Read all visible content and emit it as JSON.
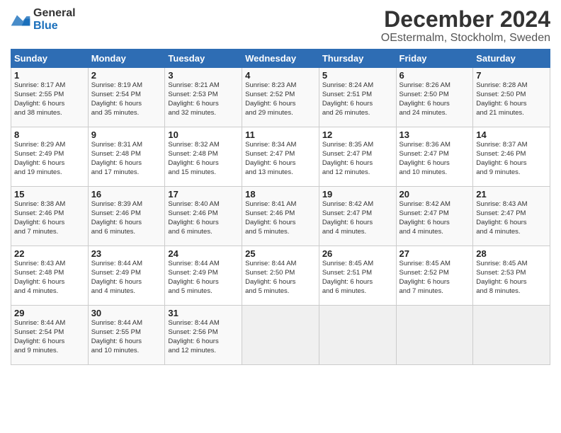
{
  "logo": {
    "general": "General",
    "blue": "Blue"
  },
  "title": "December 2024",
  "subtitle": "OEstermalm, Stockholm, Sweden",
  "headers": [
    "Sunday",
    "Monday",
    "Tuesday",
    "Wednesday",
    "Thursday",
    "Friday",
    "Saturday"
  ],
  "weeks": [
    [
      {
        "day": "1",
        "lines": [
          "Sunrise: 8:17 AM",
          "Sunset: 2:55 PM",
          "Daylight: 6 hours",
          "and 38 minutes."
        ]
      },
      {
        "day": "2",
        "lines": [
          "Sunrise: 8:19 AM",
          "Sunset: 2:54 PM",
          "Daylight: 6 hours",
          "and 35 minutes."
        ]
      },
      {
        "day": "3",
        "lines": [
          "Sunrise: 8:21 AM",
          "Sunset: 2:53 PM",
          "Daylight: 6 hours",
          "and 32 minutes."
        ]
      },
      {
        "day": "4",
        "lines": [
          "Sunrise: 8:23 AM",
          "Sunset: 2:52 PM",
          "Daylight: 6 hours",
          "and 29 minutes."
        ]
      },
      {
        "day": "5",
        "lines": [
          "Sunrise: 8:24 AM",
          "Sunset: 2:51 PM",
          "Daylight: 6 hours",
          "and 26 minutes."
        ]
      },
      {
        "day": "6",
        "lines": [
          "Sunrise: 8:26 AM",
          "Sunset: 2:50 PM",
          "Daylight: 6 hours",
          "and 24 minutes."
        ]
      },
      {
        "day": "7",
        "lines": [
          "Sunrise: 8:28 AM",
          "Sunset: 2:50 PM",
          "Daylight: 6 hours",
          "and 21 minutes."
        ]
      }
    ],
    [
      {
        "day": "8",
        "lines": [
          "Sunrise: 8:29 AM",
          "Sunset: 2:49 PM",
          "Daylight: 6 hours",
          "and 19 minutes."
        ]
      },
      {
        "day": "9",
        "lines": [
          "Sunrise: 8:31 AM",
          "Sunset: 2:48 PM",
          "Daylight: 6 hours",
          "and 17 minutes."
        ]
      },
      {
        "day": "10",
        "lines": [
          "Sunrise: 8:32 AM",
          "Sunset: 2:48 PM",
          "Daylight: 6 hours",
          "and 15 minutes."
        ]
      },
      {
        "day": "11",
        "lines": [
          "Sunrise: 8:34 AM",
          "Sunset: 2:47 PM",
          "Daylight: 6 hours",
          "and 13 minutes."
        ]
      },
      {
        "day": "12",
        "lines": [
          "Sunrise: 8:35 AM",
          "Sunset: 2:47 PM",
          "Daylight: 6 hours",
          "and 12 minutes."
        ]
      },
      {
        "day": "13",
        "lines": [
          "Sunrise: 8:36 AM",
          "Sunset: 2:47 PM",
          "Daylight: 6 hours",
          "and 10 minutes."
        ]
      },
      {
        "day": "14",
        "lines": [
          "Sunrise: 8:37 AM",
          "Sunset: 2:46 PM",
          "Daylight: 6 hours",
          "and 9 minutes."
        ]
      }
    ],
    [
      {
        "day": "15",
        "lines": [
          "Sunrise: 8:38 AM",
          "Sunset: 2:46 PM",
          "Daylight: 6 hours",
          "and 7 minutes."
        ]
      },
      {
        "day": "16",
        "lines": [
          "Sunrise: 8:39 AM",
          "Sunset: 2:46 PM",
          "Daylight: 6 hours",
          "and 6 minutes."
        ]
      },
      {
        "day": "17",
        "lines": [
          "Sunrise: 8:40 AM",
          "Sunset: 2:46 PM",
          "Daylight: 6 hours",
          "and 6 minutes."
        ]
      },
      {
        "day": "18",
        "lines": [
          "Sunrise: 8:41 AM",
          "Sunset: 2:46 PM",
          "Daylight: 6 hours",
          "and 5 minutes."
        ]
      },
      {
        "day": "19",
        "lines": [
          "Sunrise: 8:42 AM",
          "Sunset: 2:47 PM",
          "Daylight: 6 hours",
          "and 4 minutes."
        ]
      },
      {
        "day": "20",
        "lines": [
          "Sunrise: 8:42 AM",
          "Sunset: 2:47 PM",
          "Daylight: 6 hours",
          "and 4 minutes."
        ]
      },
      {
        "day": "21",
        "lines": [
          "Sunrise: 8:43 AM",
          "Sunset: 2:47 PM",
          "Daylight: 6 hours",
          "and 4 minutes."
        ]
      }
    ],
    [
      {
        "day": "22",
        "lines": [
          "Sunrise: 8:43 AM",
          "Sunset: 2:48 PM",
          "Daylight: 6 hours",
          "and 4 minutes."
        ]
      },
      {
        "day": "23",
        "lines": [
          "Sunrise: 8:44 AM",
          "Sunset: 2:49 PM",
          "Daylight: 6 hours",
          "and 4 minutes."
        ]
      },
      {
        "day": "24",
        "lines": [
          "Sunrise: 8:44 AM",
          "Sunset: 2:49 PM",
          "Daylight: 6 hours",
          "and 5 minutes."
        ]
      },
      {
        "day": "25",
        "lines": [
          "Sunrise: 8:44 AM",
          "Sunset: 2:50 PM",
          "Daylight: 6 hours",
          "and 5 minutes."
        ]
      },
      {
        "day": "26",
        "lines": [
          "Sunrise: 8:45 AM",
          "Sunset: 2:51 PM",
          "Daylight: 6 hours",
          "and 6 minutes."
        ]
      },
      {
        "day": "27",
        "lines": [
          "Sunrise: 8:45 AM",
          "Sunset: 2:52 PM",
          "Daylight: 6 hours",
          "and 7 minutes."
        ]
      },
      {
        "day": "28",
        "lines": [
          "Sunrise: 8:45 AM",
          "Sunset: 2:53 PM",
          "Daylight: 6 hours",
          "and 8 minutes."
        ]
      }
    ],
    [
      {
        "day": "29",
        "lines": [
          "Sunrise: 8:44 AM",
          "Sunset: 2:54 PM",
          "Daylight: 6 hours",
          "and 9 minutes."
        ]
      },
      {
        "day": "30",
        "lines": [
          "Sunrise: 8:44 AM",
          "Sunset: 2:55 PM",
          "Daylight: 6 hours",
          "and 10 minutes."
        ]
      },
      {
        "day": "31",
        "lines": [
          "Sunrise: 8:44 AM",
          "Sunset: 2:56 PM",
          "Daylight: 6 hours",
          "and 12 minutes."
        ]
      },
      null,
      null,
      null,
      null
    ]
  ]
}
